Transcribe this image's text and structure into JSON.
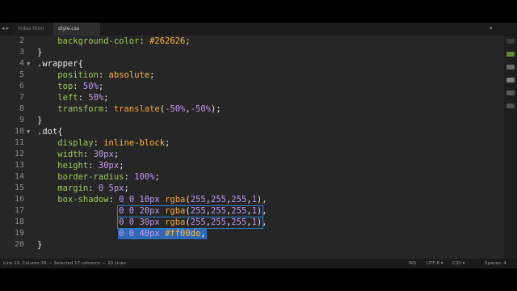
{
  "tabs": [
    {
      "label": "index.html",
      "active": false
    },
    {
      "label": "style.css",
      "active": true
    }
  ],
  "tab_controls": {
    "left": "◂ ▸",
    "right": "▾"
  },
  "line_numbers": [
    "2",
    "3",
    "4",
    "5",
    "6",
    "7",
    "8",
    "9",
    "10",
    "11",
    "12",
    "13",
    "14",
    "15",
    "16",
    "17",
    "18",
    "19",
    "20"
  ],
  "code_lines": [
    {
      "indent": "    ",
      "parts": [
        {
          "t": "background-color",
          "c": "prop"
        },
        {
          "t": ": ",
          "c": "punc"
        },
        {
          "t": "#262626",
          "c": "val"
        },
        {
          "t": ";",
          "c": "punc"
        }
      ]
    },
    {
      "indent": "",
      "parts": [
        {
          "t": "}",
          "c": "punc"
        }
      ]
    },
    {
      "indent": "",
      "parts": [
        {
          "t": ".wrapper",
          "c": "sel"
        },
        {
          "t": "{",
          "c": "punc"
        }
      ]
    },
    {
      "indent": "    ",
      "parts": [
        {
          "t": "position",
          "c": "prop"
        },
        {
          "t": ": ",
          "c": "punc"
        },
        {
          "t": "absolute",
          "c": "val"
        },
        {
          "t": ";",
          "c": "punc"
        }
      ]
    },
    {
      "indent": "    ",
      "parts": [
        {
          "t": "top",
          "c": "prop"
        },
        {
          "t": ": ",
          "c": "punc"
        },
        {
          "t": "50%",
          "c": "num"
        },
        {
          "t": ";",
          "c": "punc"
        }
      ]
    },
    {
      "indent": "    ",
      "parts": [
        {
          "t": "left",
          "c": "prop"
        },
        {
          "t": ": ",
          "c": "punc"
        },
        {
          "t": "50%",
          "c": "num"
        },
        {
          "t": ";",
          "c": "punc"
        }
      ]
    },
    {
      "indent": "    ",
      "parts": [
        {
          "t": "transform",
          "c": "prop"
        },
        {
          "t": ": ",
          "c": "punc"
        },
        {
          "t": "translate",
          "c": "fn"
        },
        {
          "t": "(",
          "c": "punc"
        },
        {
          "t": "-50%",
          "c": "num"
        },
        {
          "t": ",",
          "c": "punc"
        },
        {
          "t": "-50%",
          "c": "num"
        },
        {
          "t": ");",
          "c": "punc"
        }
      ]
    },
    {
      "indent": "",
      "parts": [
        {
          "t": "}",
          "c": "punc"
        }
      ]
    },
    {
      "indent": "",
      "parts": [
        {
          "t": ".dot",
          "c": "sel"
        },
        {
          "t": "{",
          "c": "punc"
        }
      ]
    },
    {
      "indent": "    ",
      "parts": [
        {
          "t": "display",
          "c": "prop"
        },
        {
          "t": ": ",
          "c": "punc"
        },
        {
          "t": "inline-block",
          "c": "val"
        },
        {
          "t": ";",
          "c": "punc"
        }
      ]
    },
    {
      "indent": "    ",
      "parts": [
        {
          "t": "width",
          "c": "prop"
        },
        {
          "t": ": ",
          "c": "punc"
        },
        {
          "t": "30px",
          "c": "num"
        },
        {
          "t": ";",
          "c": "punc"
        }
      ]
    },
    {
      "indent": "    ",
      "parts": [
        {
          "t": "height",
          "c": "prop"
        },
        {
          "t": ": ",
          "c": "punc"
        },
        {
          "t": "30px",
          "c": "num"
        },
        {
          "t": ";",
          "c": "punc"
        }
      ]
    },
    {
      "indent": "    ",
      "parts": [
        {
          "t": "border-radius",
          "c": "prop"
        },
        {
          "t": ": ",
          "c": "punc"
        },
        {
          "t": "100%",
          "c": "num"
        },
        {
          "t": ";",
          "c": "punc"
        }
      ]
    },
    {
      "indent": "    ",
      "parts": [
        {
          "t": "margin",
          "c": "prop"
        },
        {
          "t": ": ",
          "c": "punc"
        },
        {
          "t": "0 5px",
          "c": "num"
        },
        {
          "t": ";",
          "c": "punc"
        }
      ]
    },
    {
      "indent": "    ",
      "parts": [
        {
          "t": "box-shadow",
          "c": "prop"
        },
        {
          "t": ": ",
          "c": "punc"
        },
        {
          "t": "0 0 10px ",
          "c": "num"
        },
        {
          "t": "rgba",
          "c": "fn"
        },
        {
          "t": "(",
          "c": "punc"
        },
        {
          "t": "255",
          "c": "num"
        },
        {
          "t": ",",
          "c": "punc"
        },
        {
          "t": "255",
          "c": "num"
        },
        {
          "t": ",",
          "c": "punc"
        },
        {
          "t": "255",
          "c": "num"
        },
        {
          "t": ",",
          "c": "punc"
        },
        {
          "t": "1",
          "c": "num"
        },
        {
          "t": "),",
          "c": "punc"
        }
      ]
    },
    {
      "indent": "                ",
      "parts": [
        {
          "t": "0 0 20px ",
          "c": "num"
        },
        {
          "t": "rgba",
          "c": "fn"
        },
        {
          "t": "(",
          "c": "punc"
        },
        {
          "t": "255",
          "c": "num"
        },
        {
          "t": ",",
          "c": "punc"
        },
        {
          "t": "255",
          "c": "num"
        },
        {
          "t": ",",
          "c": "punc"
        },
        {
          "t": "255",
          "c": "num"
        },
        {
          "t": ",",
          "c": "punc"
        },
        {
          "t": "1",
          "c": "num"
        },
        {
          "t": "),",
          "c": "punc"
        }
      ]
    },
    {
      "indent": "                ",
      "parts": [
        {
          "t": "0 0 30px ",
          "c": "num"
        },
        {
          "t": "rgba",
          "c": "fn"
        },
        {
          "t": "(",
          "c": "punc"
        },
        {
          "t": "255",
          "c": "num"
        },
        {
          "t": ",",
          "c": "punc"
        },
        {
          "t": "255",
          "c": "num"
        },
        {
          "t": ",",
          "c": "punc"
        },
        {
          "t": "255",
          "c": "num"
        },
        {
          "t": ",",
          "c": "punc"
        },
        {
          "t": "1",
          "c": "num"
        },
        {
          "t": "),",
          "c": "punc"
        }
      ]
    },
    {
      "indent": "                ",
      "parts": [
        {
          "t": "0 0 40px ",
          "c": "num"
        },
        {
          "t": "#ff00de",
          "c": "val"
        },
        {
          "t": ",",
          "c": "punc"
        }
      ]
    },
    {
      "indent": "",
      "parts": [
        {
          "t": "}",
          "c": "punc"
        }
      ]
    }
  ],
  "status": {
    "position": "Line 19, Column 34 — Selected 17 columns — 20 Lines",
    "insert_mode": "INS",
    "encoding": "UTF-8",
    "encoding_arrow": "▾",
    "syntax": "CSS",
    "syntax_arrow": "▾",
    "spaces": "Spaces: 4"
  },
  "colors": {
    "background": "#262626",
    "property": "#9bcc58",
    "value": "#ffb43b",
    "number": "#c398f0",
    "selection": "#2e6ab5"
  }
}
